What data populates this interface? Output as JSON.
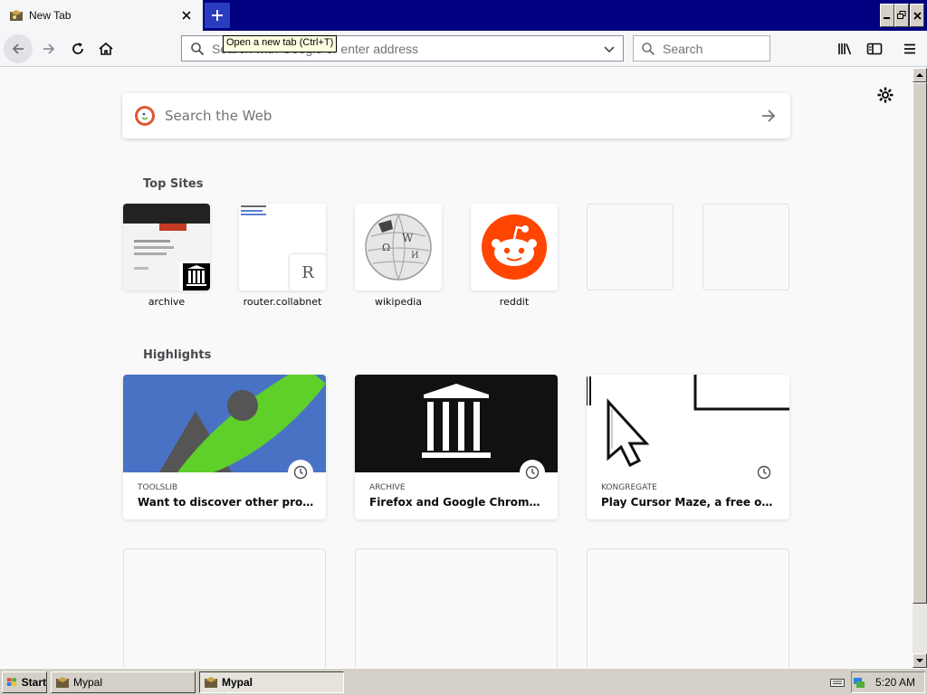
{
  "window": {
    "tab_title": "New Tab",
    "tooltip": "Open a new tab (Ctrl+T)"
  },
  "navbar": {
    "url_placeholder": "Search with Google or enter address",
    "search_placeholder": "Search"
  },
  "newtab": {
    "web_search_placeholder": "Search the Web",
    "top_sites_title": "Top Sites",
    "top_sites": [
      {
        "label": "archive"
      },
      {
        "label": "router.collabnet",
        "letter": "R"
      },
      {
        "label": "wikipedia"
      },
      {
        "label": "reddit"
      },
      {
        "label": ""
      },
      {
        "label": ""
      }
    ],
    "highlights_title": "Highlights",
    "highlights": [
      {
        "source": "TOOLSLIB",
        "title": "Want to discover other projects..."
      },
      {
        "source": "ARCHIVE",
        "title": "Firefox and Google Chrome with..."
      },
      {
        "source": "KONGREGATE",
        "title": "Play Cursor Maze, a free online g..."
      }
    ]
  },
  "taskbar": {
    "start_label": "Start",
    "tasks": [
      {
        "label": "Mypal"
      },
      {
        "label": "Mypal"
      }
    ],
    "clock": "5:20 AM"
  },
  "colors": {
    "titlebar": "#000080",
    "reddit": "#ff4500",
    "toolslib_bg": "#4a72c4",
    "rocket": "#5fcf2a"
  }
}
